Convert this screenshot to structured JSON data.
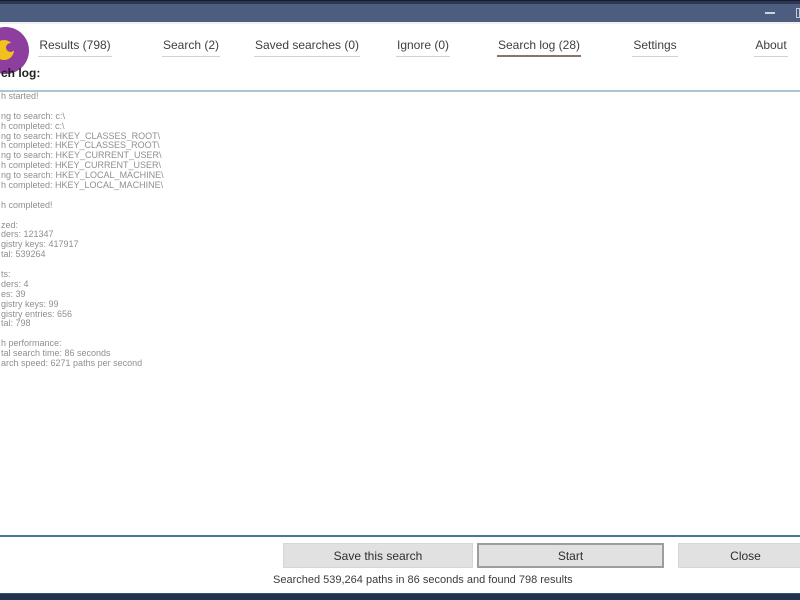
{
  "tabs": [
    {
      "label": "Results (798)",
      "active": false
    },
    {
      "label": "Search (2)",
      "active": false
    },
    {
      "label": "Saved searches (0)",
      "active": false
    },
    {
      "label": "Ignore (0)",
      "active": false
    },
    {
      "label": "Search log (28)",
      "active": true
    },
    {
      "label": "Settings",
      "active": false
    },
    {
      "label": "About",
      "active": false
    }
  ],
  "heading": "ch log:",
  "log": {
    "lines": [
      "h started!",
      "",
      "ng to search: c:\\",
      "h completed: c:\\",
      "ng to search: HKEY_CLASSES_ROOT\\",
      "h completed: HKEY_CLASSES_ROOT\\",
      "ng to search: HKEY_CURRENT_USER\\",
      "h completed: HKEY_CURRENT_USER\\",
      "ng to search: HKEY_LOCAL_MACHINE\\",
      "h completed: HKEY_LOCAL_MACHINE\\",
      "",
      "h completed!",
      "",
      "zed:",
      "ders: 121347",
      "gistry keys: 417917",
      "tal: 539264",
      "",
      "ts:",
      "ders: 4",
      "es: 39",
      "gistry keys: 99",
      "gistry entries: 656",
      "tal: 798",
      "",
      "h performance:",
      "tal search time: 86 seconds",
      "arch speed: 6271 paths per second"
    ]
  },
  "footer": {
    "save_label": "Save this search",
    "start_label": "Start",
    "close_label": "Close",
    "status": "Searched 539,264 paths in 86 seconds and found 798 results"
  },
  "colors": {
    "titlebar": "#4c5d7f",
    "titlebar_top": "#2b3752",
    "separator": "#417a97",
    "bottom_bar": "#22334d",
    "active_tab_underline": "#8c7370",
    "inactive_tab_underline": "#d9d1c7",
    "logo_purple": "#8e3e9e",
    "logo_yellow": "#f2c21c",
    "log_text": "#8f8f8f"
  }
}
